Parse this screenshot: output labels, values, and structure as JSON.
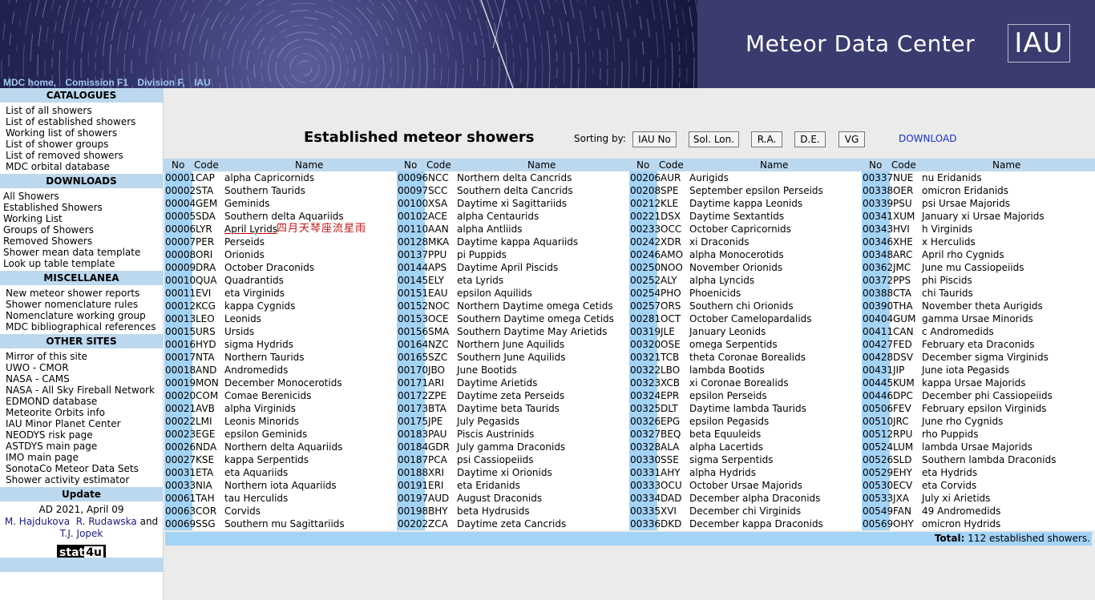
{
  "header": {
    "site_title": "Meteor Data Center",
    "logo_text": "IAU",
    "nav": [
      "MDC home,",
      "Comission F1",
      "Division F,",
      "IAU"
    ]
  },
  "sidebar": {
    "catalogues": {
      "heading": "CATALOGUES",
      "items": [
        "List of all showers",
        "List of established showers",
        "Working list of showers",
        "List of shower groups",
        "List of removed showers",
        "MDC orbital database"
      ]
    },
    "downloads": {
      "heading": "DOWNLOADS",
      "items": [
        "All Showers",
        "Established Showers",
        "Working List",
        "Groups of Showers",
        "Removed Showers",
        "Shower mean data template",
        "Look up table template"
      ]
    },
    "miscellanea": {
      "heading": "MISCELLANEA",
      "items": [
        "New meteor shower reports",
        "Shower nomenclature rules",
        "Nomenclature working group",
        "MDC bibliographical references"
      ]
    },
    "other_sites": {
      "heading": "OTHER SITES",
      "items": [
        "Mirror of this site",
        "UWO - CMOR",
        "NASA - CAMS",
        "NASA - All Sky Fireball Network",
        "EDMOND database",
        "Meteorite Orbits info",
        "IAU Minor Planet Center",
        "NEODYS risk page",
        "ASTDYS main page",
        "IMO main page",
        "SonotaCo Meteor Data Sets",
        "Shower activity estimator"
      ]
    },
    "update": {
      "heading": "Update",
      "date": "AD 2021, April 09",
      "author1": "M. Hajdukova",
      "author2": "R. Rudawska",
      "and": "and",
      "author3": "T.J. Jopek",
      "badge_a": "stat",
      "badge_b": "4u"
    }
  },
  "main": {
    "title": "Established meteor showers",
    "sort_label": "Sorting by:",
    "sort_buttons": [
      "IAU No",
      "Sol. Lon.",
      "R.A.",
      "D.E.",
      "VG"
    ],
    "download": "DOWNLOAD",
    "headers": {
      "no": "No",
      "code": "Code",
      "name": "Name"
    },
    "annotation": "四月天琴座流星雨",
    "columns": [
      [
        [
          "00001",
          "CAP",
          "alpha Capricornids"
        ],
        [
          "00002",
          "STA",
          "Southern Taurids"
        ],
        [
          "00004",
          "GEM",
          "Geminids"
        ],
        [
          "00005",
          "SDA",
          "Southern delta Aquariids"
        ],
        [
          "00006",
          "LYR",
          "April Lyrids"
        ],
        [
          "00007",
          "PER",
          "Perseids"
        ],
        [
          "00008",
          "ORI",
          "Orionids"
        ],
        [
          "00009",
          "DRA",
          "October Draconids"
        ],
        [
          "00010",
          "QUA",
          "Quadrantids"
        ],
        [
          "00011",
          "EVI",
          "eta Virginids"
        ],
        [
          "00012",
          "KCG",
          "kappa Cygnids"
        ],
        [
          "00013",
          "LEO",
          "Leonids"
        ],
        [
          "00015",
          "URS",
          "Ursids"
        ],
        [
          "00016",
          "HYD",
          "sigma Hydrids"
        ],
        [
          "00017",
          "NTA",
          "Northern Taurids"
        ],
        [
          "00018",
          "AND",
          "Andromedids"
        ],
        [
          "00019",
          "MON",
          "December Monocerotids"
        ],
        [
          "00020",
          "COM",
          "Comae Berenicids"
        ],
        [
          "00021",
          "AVB",
          "alpha Virginids"
        ],
        [
          "00022",
          "LMI",
          "Leonis Minorids"
        ],
        [
          "00023",
          "EGE",
          "epsilon Geminids"
        ],
        [
          "00026",
          "NDA",
          "Northern delta Aquariids"
        ],
        [
          "00027",
          "KSE",
          "kappa Serpentids"
        ],
        [
          "00031",
          "ETA",
          "eta Aquariids"
        ],
        [
          "00033",
          "NIA",
          "Northern iota Aquariids"
        ],
        [
          "00061",
          "TAH",
          "tau Herculids"
        ],
        [
          "00063",
          "COR",
          "Corvids"
        ],
        [
          "00069",
          "SSG",
          "Southern mu Sagittariids"
        ]
      ],
      [
        [
          "00096",
          "NCC",
          "Northern delta Cancrids"
        ],
        [
          "00097",
          "SCC",
          "Southern delta Cancrids"
        ],
        [
          "00100",
          "XSA",
          "Daytime xi Sagittariids"
        ],
        [
          "00102",
          "ACE",
          "alpha Centaurids"
        ],
        [
          "00110",
          "AAN",
          "alpha Antliids"
        ],
        [
          "00128",
          "MKA",
          "Daytime kappa Aquariids"
        ],
        [
          "00137",
          "PPU",
          "pi Puppids"
        ],
        [
          "00144",
          "APS",
          "Daytime April Piscids"
        ],
        [
          "00145",
          "ELY",
          "eta Lyrids"
        ],
        [
          "00151",
          "EAU",
          "epsilon Aquilids"
        ],
        [
          "00152",
          "NOC",
          "Northern Daytime omega Cetids"
        ],
        [
          "00153",
          "OCE",
          "Southern Daytime omega Cetids"
        ],
        [
          "00156",
          "SMA",
          "Southern Daytime May Arietids"
        ],
        [
          "00164",
          "NZC",
          "Northern June Aquilids"
        ],
        [
          "00165",
          "SZC",
          "Southern June Aquilids"
        ],
        [
          "00170",
          "JBO",
          "June Bootids"
        ],
        [
          "00171",
          "ARI",
          "Daytime Arietids"
        ],
        [
          "00172",
          "ZPE",
          "Daytime zeta Perseids"
        ],
        [
          "00173",
          "BTA",
          "Daytime beta Taurids"
        ],
        [
          "00175",
          "JPE",
          "July Pegasids"
        ],
        [
          "00183",
          "PAU",
          "Piscis Austrinids"
        ],
        [
          "00184",
          "GDR",
          "July gamma Draconids"
        ],
        [
          "00187",
          "PCA",
          "psi Cassiopeiids"
        ],
        [
          "00188",
          "XRI",
          "Daytime xi Orionids"
        ],
        [
          "00191",
          "ERI",
          "eta Eridanids"
        ],
        [
          "00197",
          "AUD",
          "August Draconids"
        ],
        [
          "00198",
          "BHY",
          "beta Hydrusids"
        ],
        [
          "00202",
          "ZCA",
          "Daytime zeta Cancrids"
        ]
      ],
      [
        [
          "00206",
          "AUR",
          "Aurigids"
        ],
        [
          "00208",
          "SPE",
          "September epsilon Perseids"
        ],
        [
          "00212",
          "KLE",
          "Daytime kappa Leonids"
        ],
        [
          "00221",
          "DSX",
          "Daytime Sextantids"
        ],
        [
          "00233",
          "OCC",
          "October Capricornids"
        ],
        [
          "00242",
          "XDR",
          "xi Draconids"
        ],
        [
          "00246",
          "AMO",
          "alpha Monocerotids"
        ],
        [
          "00250",
          "NOO",
          "November Orionids"
        ],
        [
          "00252",
          "ALY",
          "alpha Lyncids"
        ],
        [
          "00254",
          "PHO",
          "Phoenicids"
        ],
        [
          "00257",
          "ORS",
          "Southern chi Orionids"
        ],
        [
          "00281",
          "OCT",
          "October Camelopardalids"
        ],
        [
          "00319",
          "JLE",
          "January Leonids"
        ],
        [
          "00320",
          "OSE",
          "omega Serpentids"
        ],
        [
          "00321",
          "TCB",
          "theta Coronae Borealids"
        ],
        [
          "00322",
          "LBO",
          "lambda Bootids"
        ],
        [
          "00323",
          "XCB",
          "xi Coronae Borealids"
        ],
        [
          "00324",
          "EPR",
          "epsilon Perseids"
        ],
        [
          "00325",
          "DLT",
          "Daytime lambda Taurids"
        ],
        [
          "00326",
          "EPG",
          "epsilon Pegasids"
        ],
        [
          "00327",
          "BEQ",
          "beta Equuleids"
        ],
        [
          "00328",
          "ALA",
          "alpha Lacertids"
        ],
        [
          "00330",
          "SSE",
          "sigma Serpentids"
        ],
        [
          "00331",
          "AHY",
          "alpha Hydrids"
        ],
        [
          "00333",
          "OCU",
          "October Ursae Majorids"
        ],
        [
          "00334",
          "DAD",
          "December alpha Draconids"
        ],
        [
          "00335",
          "XVI",
          "December chi Virginids"
        ],
        [
          "00336",
          "DKD",
          "December kappa Draconids"
        ]
      ],
      [
        [
          "00337",
          "NUE",
          "nu Eridanids"
        ],
        [
          "00338",
          "OER",
          "omicron Eridanids"
        ],
        [
          "00339",
          "PSU",
          "psi Ursae Majorids"
        ],
        [
          "00341",
          "XUM",
          "January xi Ursae Majorids"
        ],
        [
          "00343",
          "HVI",
          "h Virginids"
        ],
        [
          "00346",
          "XHE",
          "x Herculids"
        ],
        [
          "00348",
          "ARC",
          "April rho Cygnids"
        ],
        [
          "00362",
          "JMC",
          "June mu Cassiopeiids"
        ],
        [
          "00372",
          "PPS",
          "phi Piscids"
        ],
        [
          "00388",
          "CTA",
          "chi Taurids"
        ],
        [
          "00390",
          "THA",
          "November theta Aurigids"
        ],
        [
          "00404",
          "GUM",
          "gamma Ursae Minorids"
        ],
        [
          "00411",
          "CAN",
          "c Andromedids"
        ],
        [
          "00427",
          "FED",
          "February eta Draconids"
        ],
        [
          "00428",
          "DSV",
          "December sigma Virginids"
        ],
        [
          "00431",
          "JIP",
          "June iota Pegasids"
        ],
        [
          "00445",
          "KUM",
          "kappa Ursae Majorids"
        ],
        [
          "00446",
          "DPC",
          "December phi Cassiopeiids"
        ],
        [
          "00506",
          "FEV",
          "February epsilon Virginids"
        ],
        [
          "00510",
          "JRC",
          "June rho Cygnids"
        ],
        [
          "00512",
          "RPU",
          "rho Puppids"
        ],
        [
          "00524",
          "LUM",
          "lambda Ursae Majorids"
        ],
        [
          "00526",
          "SLD",
          "Southern lambda Draconids"
        ],
        [
          "00529",
          "EHY",
          "eta Hydrids"
        ],
        [
          "00530",
          "ECV",
          "eta Corvids"
        ],
        [
          "00533",
          "JXA",
          "July xi Arietids"
        ],
        [
          "00549",
          "FAN",
          "49 Andromedids"
        ],
        [
          "00569",
          "OHY",
          "omicron Hydrids"
        ]
      ]
    ],
    "total_label": "Total:",
    "total_value": "112 established showers."
  },
  "colors": {
    "banner": "#1e1f4a",
    "title_bar": "#3a3b6e",
    "side_head": "#bcd8ee",
    "no_cell": "#a3d3f5",
    "link": "#1c2fd0",
    "annotation": "#c41414"
  }
}
